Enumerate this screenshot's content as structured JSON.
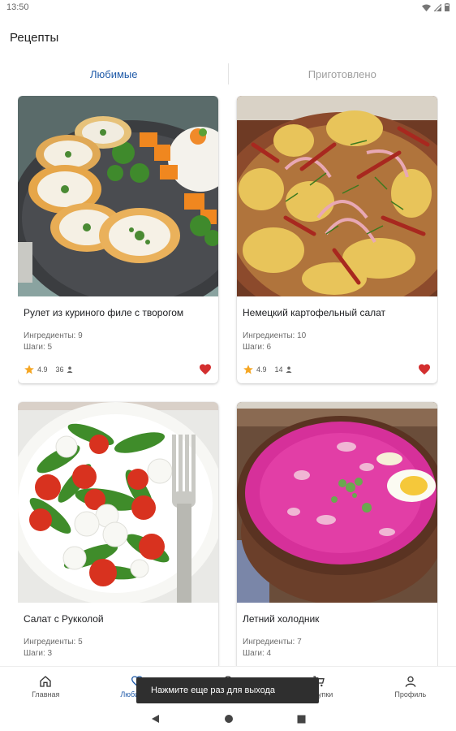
{
  "status_bar": {
    "time": "13:50"
  },
  "app": {
    "title": "Рецепты"
  },
  "tabs": [
    {
      "label": "Любимые",
      "active": true
    },
    {
      "label": "Приготовлено",
      "active": false
    }
  ],
  "recipes": [
    {
      "title": "Рулет из куриного филе с творогом",
      "ingredients": "Ингредиенты: 9",
      "steps": "Шаги: 5",
      "rating": "4.9",
      "people": "36",
      "favorite": true
    },
    {
      "title": "Немецкий картофельный салат",
      "ingredients": "Ингредиенты: 10",
      "steps": "Шаги: 6",
      "rating": "4.9",
      "people": "14",
      "favorite": true
    },
    {
      "title": "Салат с Рукколой",
      "ingredients": "Ингредиенты: 5",
      "steps": "Шаги: 3"
    },
    {
      "title": "Летний холодник",
      "ingredients": "Ингредиенты: 7",
      "steps": "Шаги: 4"
    }
  ],
  "bottom_nav": [
    {
      "label": "Главная",
      "icon": "home-icon"
    },
    {
      "label": "Любимые",
      "icon": "heart-outline-icon",
      "active": true
    },
    {
      "label": "",
      "icon": "chef-hat-icon"
    },
    {
      "label": "Покупки",
      "icon": "cart-icon"
    },
    {
      "label": "Профиль",
      "icon": "person-icon"
    }
  ],
  "toast": {
    "text": "Нажмите еще раз для выхода"
  },
  "colors": {
    "accent": "#1f5aa8",
    "star": "#f5a623",
    "heart": "#d32f2f"
  }
}
